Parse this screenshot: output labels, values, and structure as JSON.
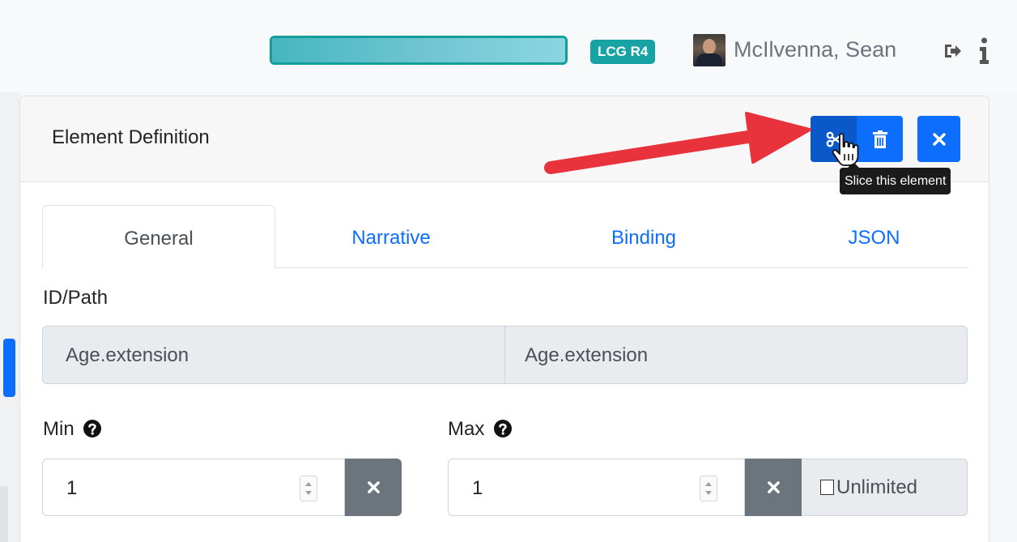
{
  "header": {
    "progress_percent": 100,
    "badge": "LCG R4",
    "user_name": "McIlvenna, Sean",
    "icons": [
      "avatar",
      "sign-out-icon",
      "info-icon"
    ]
  },
  "panel": {
    "title": "Element Definition",
    "buttons": {
      "slice_icon": "scissors-icon",
      "delete_icon": "trash-icon",
      "close_icon": "close-icon"
    },
    "tooltip": "Slice this element"
  },
  "tabs": [
    {
      "label": "General",
      "active": true
    },
    {
      "label": "Narrative",
      "active": false
    },
    {
      "label": "Binding",
      "active": false
    },
    {
      "label": "JSON",
      "active": false
    }
  ],
  "form": {
    "id_path_label": "ID/Path",
    "id_value": "Age.extension",
    "path_value": "Age.extension",
    "min_label": "Min",
    "min_value": "1",
    "max_label": "Max",
    "max_value": "1",
    "unlimited_label": "Unlimited",
    "unlimited_checked": false
  },
  "colors": {
    "primary": "#0d6efd",
    "badge": "#17a2a4",
    "annotation_arrow": "#e8323c"
  }
}
